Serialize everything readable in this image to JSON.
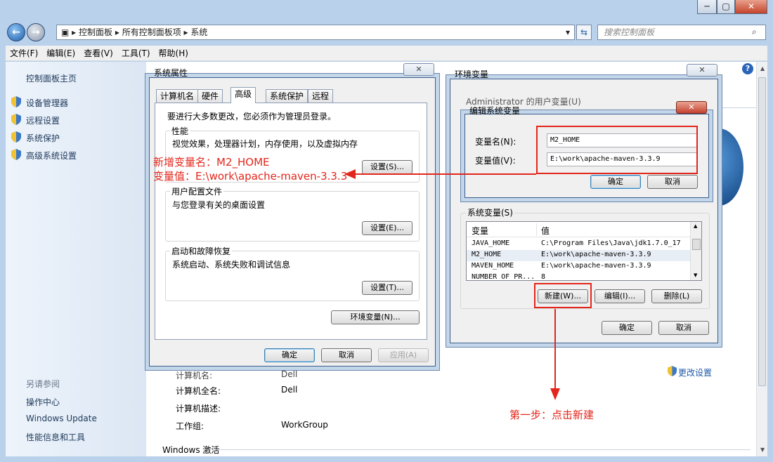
{
  "window": {
    "controls": [
      "─",
      "▢",
      "✕"
    ],
    "breadcrumb": [
      "控制面板",
      "所有控制面板项",
      "系统"
    ],
    "search_placeholder": "搜索控制面板"
  },
  "menu": [
    "文件(F)",
    "编辑(E)",
    "查看(V)",
    "工具(T)",
    "帮助(H)"
  ],
  "left_pane": {
    "home": "控制面板主页",
    "links": [
      "设备管理器",
      "远程设置",
      "系统保护",
      "高级系统设置"
    ],
    "see_also_label": "另请参阅",
    "see_also": [
      "操作中心",
      "Windows Update",
      "性能信息和工具"
    ]
  },
  "main": {
    "rows": [
      {
        "label": "计算机名:",
        "value": "Dell"
      },
      {
        "label": "计算机全名:",
        "value": "Dell"
      },
      {
        "label": "计算机描述:",
        "value": ""
      },
      {
        "label": "工作组:",
        "value": "WorkGroup"
      }
    ],
    "change_settings": "更改设置",
    "windows_activation": "Windows 激活"
  },
  "sys_props": {
    "title": "系统属性",
    "tabs": [
      "计算机名",
      "硬件",
      "高级",
      "系统保护",
      "远程"
    ],
    "admin_note": "要进行大多数更改，您必须作为管理员登录。",
    "perf": {
      "title": "性能",
      "desc": "视觉效果，处理器计划，内存使用，以及虚拟内存",
      "button": "设置(S)..."
    },
    "profile": {
      "title": "用户配置文件",
      "desc": "与您登录有关的桌面设置",
      "button": "设置(E)..."
    },
    "startup": {
      "title": "启动和故障恢复",
      "desc": "系统启动、系统失败和调试信息",
      "button": "设置(T)..."
    },
    "env_button": "环境变量(N)...",
    "ok": "确定",
    "cancel": "取消",
    "apply": "应用(A)"
  },
  "env_vars": {
    "title": "环境变量",
    "user_section": "Administrator 的用户变量(U)",
    "sys_section": "系统变量(S)",
    "col_var": "变量",
    "col_val": "值",
    "rows": [
      {
        "name": "JAVA_HOME",
        "value": "C:\\Program Files\\Java\\jdk1.7.0_17"
      },
      {
        "name": "M2_HOME",
        "value": "E:\\work\\apache-maven-3.3.9"
      },
      {
        "name": "MAVEN_HOME",
        "value": "E:\\work\\apache-maven-3.3.9"
      },
      {
        "name": "NUMBER_OF_PR...",
        "value": "8"
      }
    ],
    "new_button": "新建(W)...",
    "edit_button": "编辑(I)...",
    "delete_button": "删除(L)",
    "ok": "确定",
    "cancel": "取消"
  },
  "edit_var": {
    "title": "编辑系统变量",
    "name_label": "变量名(N):",
    "value_label": "变量值(V):",
    "name_value": "M2_HOME",
    "value_value": "E:\\work\\apache-maven-3.3.9",
    "ok": "确定",
    "cancel": "取消"
  },
  "annotations": {
    "line1": "新增变量名：M2_HOME",
    "line2": "变量值：E:\\work\\apache-maven-3.3.3",
    "step1": "第一步：点击新建"
  },
  "colors": {
    "annotation": "#e3261b",
    "link": "#1e395b"
  }
}
